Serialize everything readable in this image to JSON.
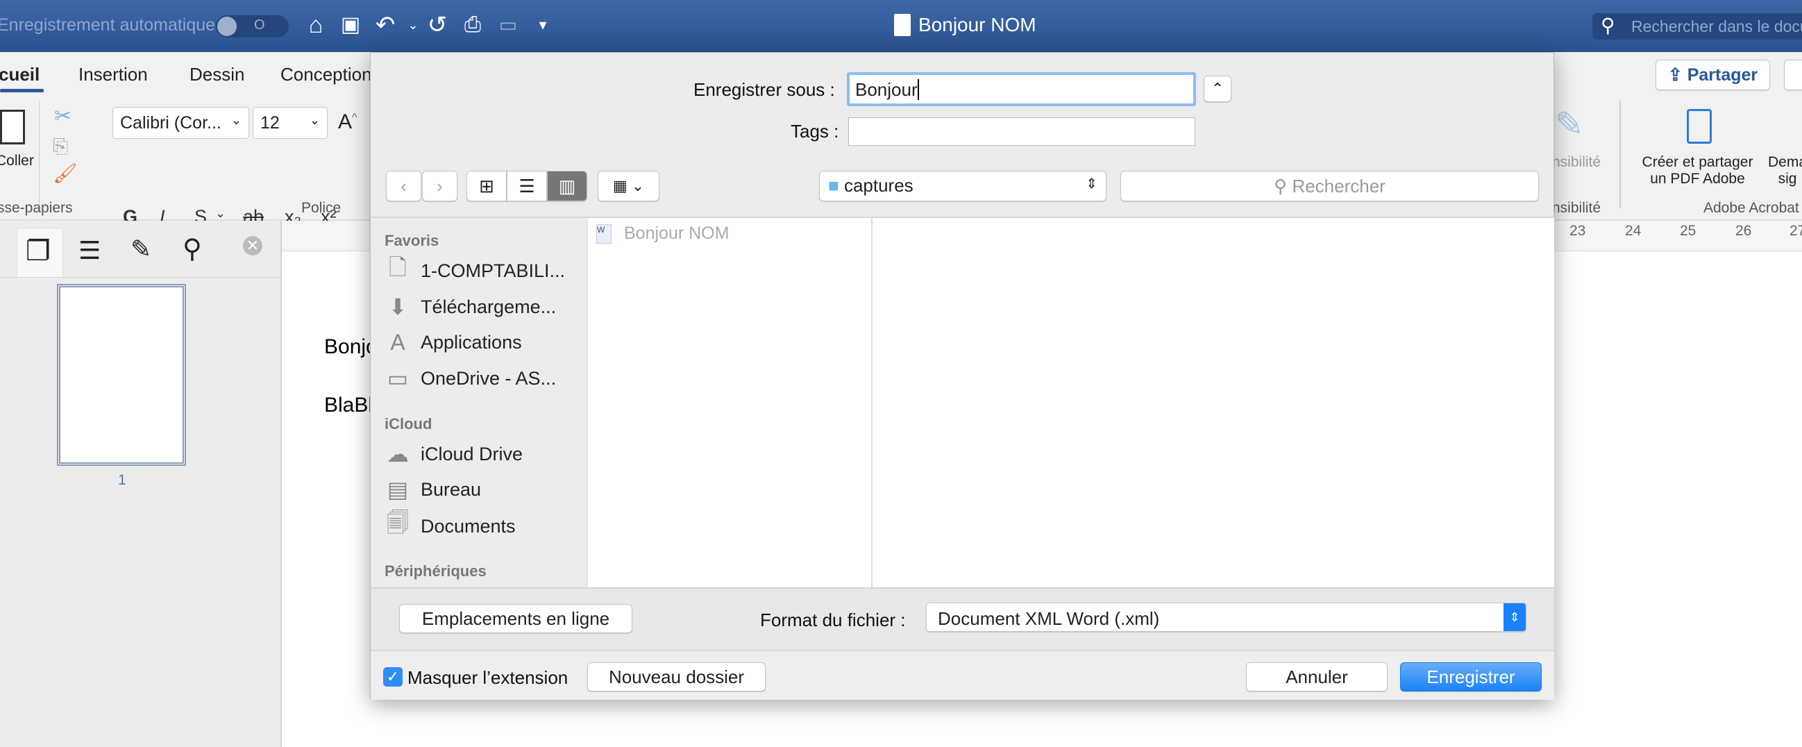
{
  "titlebar": {
    "autosave_label": "Enregistrement automatique",
    "autosave_state": "O",
    "doc_title": "Bonjour NOM",
    "search_placeholder": "Rechercher dans le docu"
  },
  "ribbon": {
    "tabs": [
      "cueil",
      "Insertion",
      "Dessin",
      "Conception"
    ],
    "active_tab": "cueil",
    "paste_label": "Coller",
    "font_name": "Calibri (Cor...",
    "font_size": "12",
    "format_buttons": [
      "G",
      "I",
      "S",
      "ab",
      "x₂",
      "x²"
    ],
    "groups": [
      "sse-papiers",
      "Police",
      "nsibilité",
      "Adobe Acrobat"
    ],
    "sensitivity_label": "nsibilité",
    "share_label": "Partager",
    "acrobat_create": [
      "Créer et partager",
      "un PDF Adobe"
    ],
    "acrobat_request": [
      "Dema",
      "sig"
    ]
  },
  "ruler": {
    "numbers": [
      "23",
      "24",
      "25",
      "26",
      "27"
    ]
  },
  "document": {
    "lines": [
      "Bonjo",
      "BlaBl"
    ]
  },
  "navpane": {
    "page_number": "1"
  },
  "dialog": {
    "save_as_label": "Enregistrer sous :",
    "save_as_value": "Bonjour",
    "tags_label": "Tags :",
    "tags_value": "",
    "location": "captures",
    "search_placeholder": "Rechercher",
    "sidebar": [
      {
        "header": "Favoris",
        "items": [
          {
            "label": "1-COMPTABILI...",
            "icon": "document-icon"
          },
          {
            "label": "Téléchargeme...",
            "icon": "download-icon"
          },
          {
            "label": "Applications",
            "icon": "applications-icon"
          },
          {
            "label": "OneDrive - AS...",
            "icon": "folder-icon"
          }
        ]
      },
      {
        "header": "iCloud",
        "items": [
          {
            "label": "iCloud Drive",
            "icon": "cloud-icon"
          },
          {
            "label": "Bureau",
            "icon": "desktop-icon"
          },
          {
            "label": "Documents",
            "icon": "documents-icon"
          }
        ]
      },
      {
        "header": "Périphériques",
        "items": []
      }
    ],
    "files": [
      "Bonjour NOM"
    ],
    "online_locations_label": "Emplacements en ligne",
    "format_label": "Format du fichier :",
    "format_value": "Document XML Word (.xml)",
    "hide_extension_label": "Masquer l’extension",
    "hide_extension_checked": true,
    "new_folder_label": "Nouveau dossier",
    "cancel_label": "Annuler",
    "save_label": "Enregistrer"
  },
  "colors": {
    "titlebar": "#2b5391",
    "accent": "#1a82fb",
    "word_blue": "#2b579a"
  }
}
